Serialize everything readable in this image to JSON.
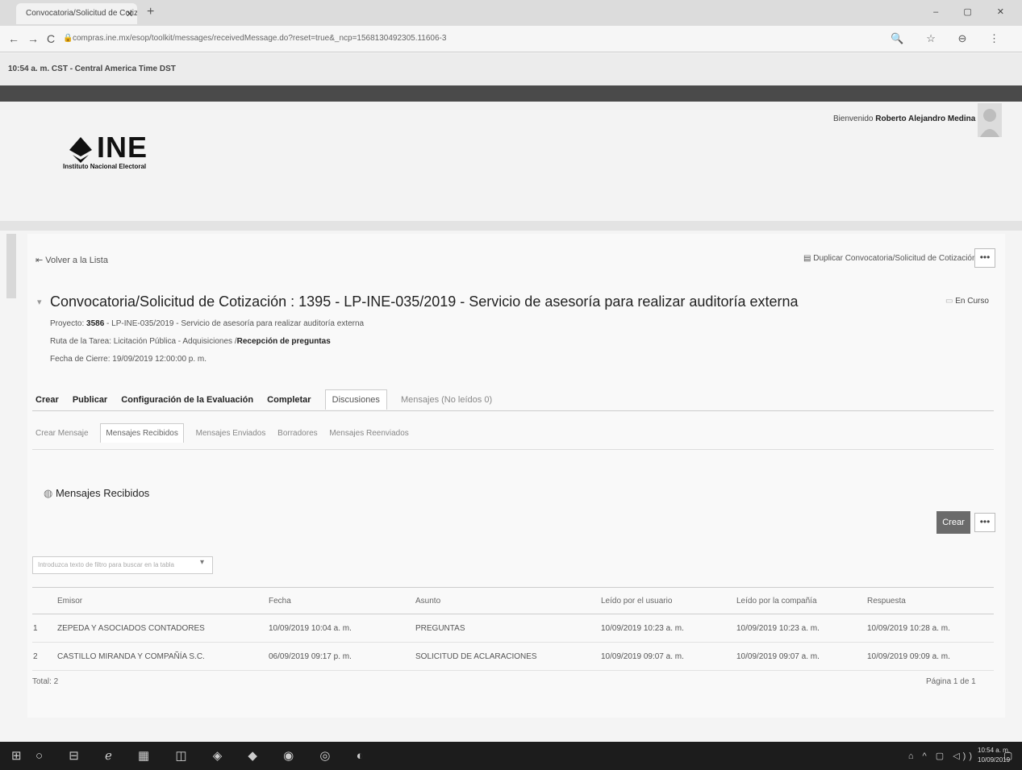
{
  "browser": {
    "tab_title": "Convocatoria/Solicitud de Cotiz...",
    "tab_close": "✕",
    "new_tab": "+",
    "window_controls": "– ▢ ✕",
    "url": "compras.ine.mx/esop/toolkit/messages/receivedMessage.do?reset=true&_ncp=1568130492305.11606-3",
    "nav": {
      "back": "←",
      "forward": "→",
      "reload": "C"
    },
    "url_right_icons": "🔍 ☆ ⊖ ⋮"
  },
  "time_strip": "10:54 a. m. CST - Central America Time DST",
  "header": {
    "welcome_prefix": "Bienvenido ",
    "user_name": "Roberto Alejandro Medina",
    "logo_text": "INE",
    "logo_subtitle": "Instituto Nacional Electoral"
  },
  "toolbar": {
    "back_label": "Volver a la Lista",
    "duplicate_label": "Duplicar Convocatoria/Solicitud de Cotización",
    "more": "•••"
  },
  "rfq": {
    "title": "Convocatoria/Solicitud de Cotización : 1395 - LP-INE-035/2019 - Servicio de asesoría para realizar auditoría externa",
    "status": "En Curso",
    "project_prefix": "Proyecto: ",
    "project_num": "3586",
    "project_rest": " - LP-INE-035/2019 - Servicio de asesoría para realizar auditoría externa",
    "route_prefix": "Ruta de la Tarea: Licitación Pública - Adquisiciones /",
    "route_current": "Recepción de preguntas",
    "close_date": "Fecha de Cierre: 19/09/2019 12:00:00 p. m."
  },
  "tabs_main": [
    {
      "label": "Crear"
    },
    {
      "label": "Publicar"
    },
    {
      "label": "Configuración de la Evaluación"
    },
    {
      "label": "Completar"
    },
    {
      "label": "Discusiones"
    },
    {
      "label": "Mensajes (No leídos 0)"
    }
  ],
  "tabs_sub": [
    {
      "label": "Crear Mensaje"
    },
    {
      "label": "Mensajes Recibidos"
    },
    {
      "label": "Mensajes Enviados"
    },
    {
      "label": "Borradores"
    },
    {
      "label": "Mensajes Reenviados"
    }
  ],
  "messages": {
    "section_title": "Mensajes Recibidos",
    "create_button": "Crear",
    "more": "•••",
    "filter_placeholder": "Introduzca texto de filtro para buscar en la tabla",
    "columns": [
      "Emisor",
      "Fecha",
      "Asunto",
      "Leído por el usuario",
      "Leído por la compañía",
      "Respuesta"
    ],
    "rows": [
      {
        "n": "1",
        "emisor": "ZEPEDA Y ASOCIADOS CONTADORES",
        "fecha": "10/09/2019 10:04 a. m.",
        "asunto": "PREGUNTAS",
        "leido_usuario": "10/09/2019 10:23 a. m.",
        "leido_compania": "10/09/2019 10:23 a. m.",
        "respuesta": "10/09/2019 10:28 a. m."
      },
      {
        "n": "2",
        "emisor": "CASTILLO MIRANDA Y COMPAÑÍA S.C.",
        "fecha": "06/09/2019 09:17 p. m.",
        "asunto": "SOLICITUD DE ACLARACIONES",
        "leido_usuario": "10/09/2019 09:07 a. m.",
        "leido_compania": "10/09/2019 09:07 a. m.",
        "respuesta": "10/09/2019 09:09 a. m."
      }
    ],
    "total": "Total: 2",
    "pagination": "Página 1 de 1"
  },
  "taskbar": {
    "start": "⊞",
    "icons": "○ ⊟ ℯ ▦ ◫ ◈ ◆ ◉ ◎ ◐",
    "tray": "⌂ ^ ▢ ◁))",
    "time": "10:54 a. m.",
    "date": "10/09/2019",
    "notifications": "▢"
  }
}
